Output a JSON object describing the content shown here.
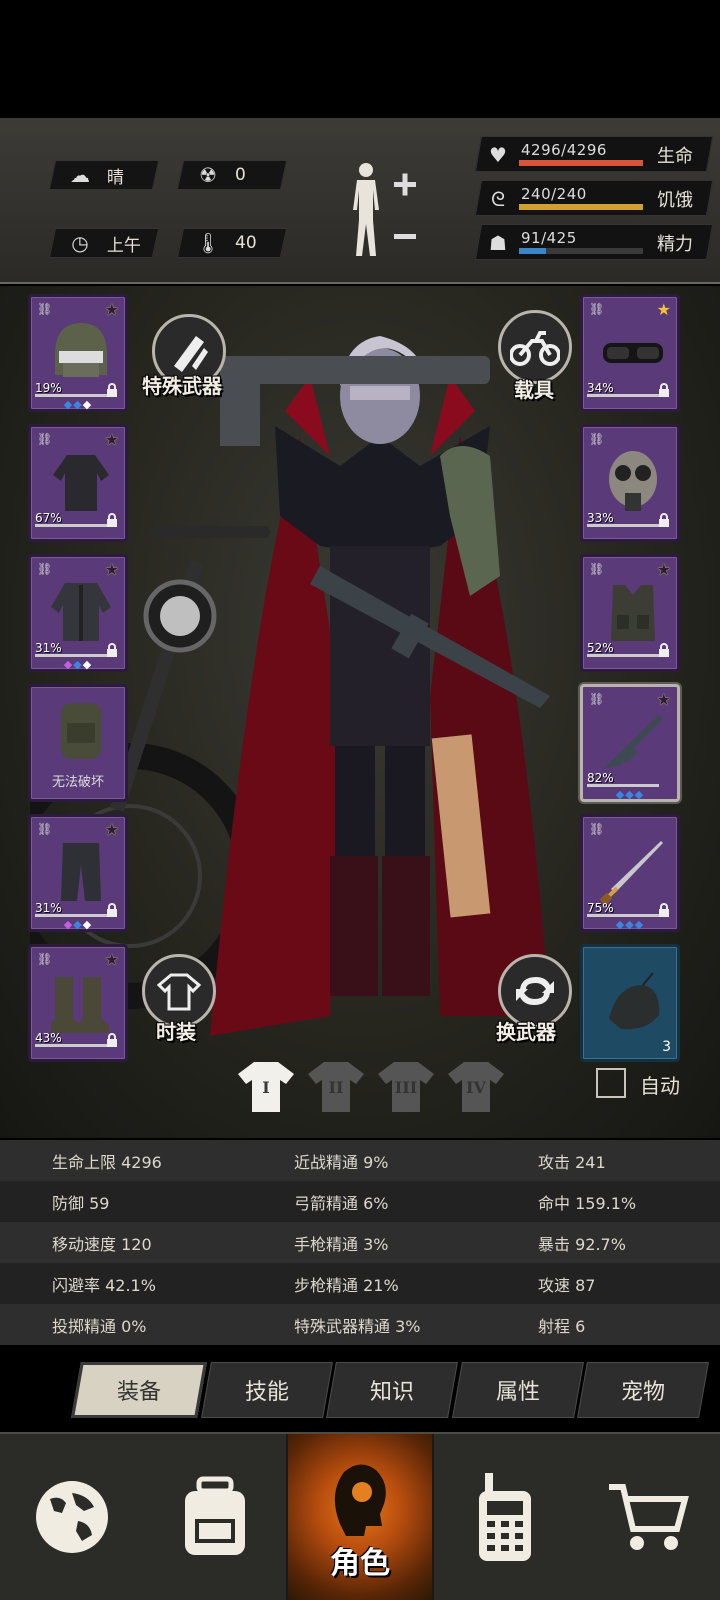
{
  "environment": {
    "weather": {
      "icon": "cloud-sun-icon",
      "label": "晴"
    },
    "radiation": {
      "icon": "radiation-icon",
      "value": "0"
    },
    "time": {
      "icon": "clock-icon",
      "label": "上午"
    },
    "temperature": {
      "icon": "thermometer-icon",
      "value": "40"
    }
  },
  "vitals": [
    {
      "key": "life",
      "icon": "heart-icon",
      "value": "4296/4296",
      "label": "生命",
      "fraction": 1.0,
      "color": "#d9553a"
    },
    {
      "key": "hunger",
      "icon": "stomach-icon",
      "value": "240/240",
      "label": "饥饿",
      "fraction": 1.0,
      "color": "#d2a032"
    },
    {
      "key": "energy",
      "icon": "brain-icon",
      "value": "91/425",
      "label": "精力",
      "fraction": 0.214,
      "color": "#3a86c8"
    }
  ],
  "left_slots": [
    {
      "name": "helmet",
      "percent": "19%",
      "star": true,
      "gems": [
        "#3a86e0",
        "#3a86e0",
        "#ffffff"
      ]
    },
    {
      "name": "shirt",
      "percent": "67%",
      "star": true,
      "gems": []
    },
    {
      "name": "jacket",
      "percent": "31%",
      "star": true,
      "gems": [
        "#c060e0",
        "#3a86e0",
        "#ffffff"
      ]
    },
    {
      "name": "backpack",
      "label": "无法破坏",
      "star": false,
      "gems": []
    },
    {
      "name": "pants",
      "percent": "31%",
      "star": true,
      "gems": [
        "#c060e0",
        "#3a86e0",
        "#ffffff"
      ]
    },
    {
      "name": "boots",
      "percent": "43%",
      "star": true,
      "gems": []
    }
  ],
  "right_slots": [
    {
      "name": "goggles",
      "percent": "34%",
      "star": true,
      "star_filled": true,
      "gems": []
    },
    {
      "name": "gas-mask",
      "percent": "33%",
      "star": false,
      "gems": []
    },
    {
      "name": "vest",
      "percent": "52%",
      "star": true,
      "gems": []
    },
    {
      "name": "rifle",
      "percent": "82%",
      "star": true,
      "gems": [
        "#3a86e0",
        "#3a86e0",
        "#3a86e0"
      ]
    },
    {
      "name": "sword",
      "percent": "75%",
      "star": false,
      "gems": [
        "#3a86e0",
        "#3a86e0",
        "#3a86e0"
      ]
    },
    {
      "name": "throwable-bag",
      "count": "3"
    }
  ],
  "buttons": {
    "special_weapon": "特殊武器",
    "vehicle": "载具",
    "fashion": "时装",
    "swap_weapon": "换武器"
  },
  "outfit_tabs": [
    "I",
    "II",
    "III",
    "IV"
  ],
  "auto_label": "自动",
  "stats": [
    [
      "生命上限 4296",
      "近战精通 9%",
      "攻击 241"
    ],
    [
      "防御 59",
      "弓箭精通 6%",
      "命中 159.1%"
    ],
    [
      "移动速度 120",
      "手枪精通 3%",
      "暴击 92.7%"
    ],
    [
      "闪避率 42.1%",
      "步枪精通 21%",
      "攻速 87"
    ],
    [
      "投掷精通 0%",
      "特殊武器精通 3%",
      "射程 6"
    ]
  ],
  "subtabs": [
    "装备",
    "技能",
    "知识",
    "属性",
    "宠物"
  ],
  "nav": [
    {
      "icon": "globe-icon",
      "label": ""
    },
    {
      "icon": "backpack-icon",
      "label": ""
    },
    {
      "icon": "head-icon",
      "label": "角色"
    },
    {
      "icon": "radio-icon",
      "label": ""
    },
    {
      "icon": "cart-icon",
      "label": ""
    }
  ]
}
